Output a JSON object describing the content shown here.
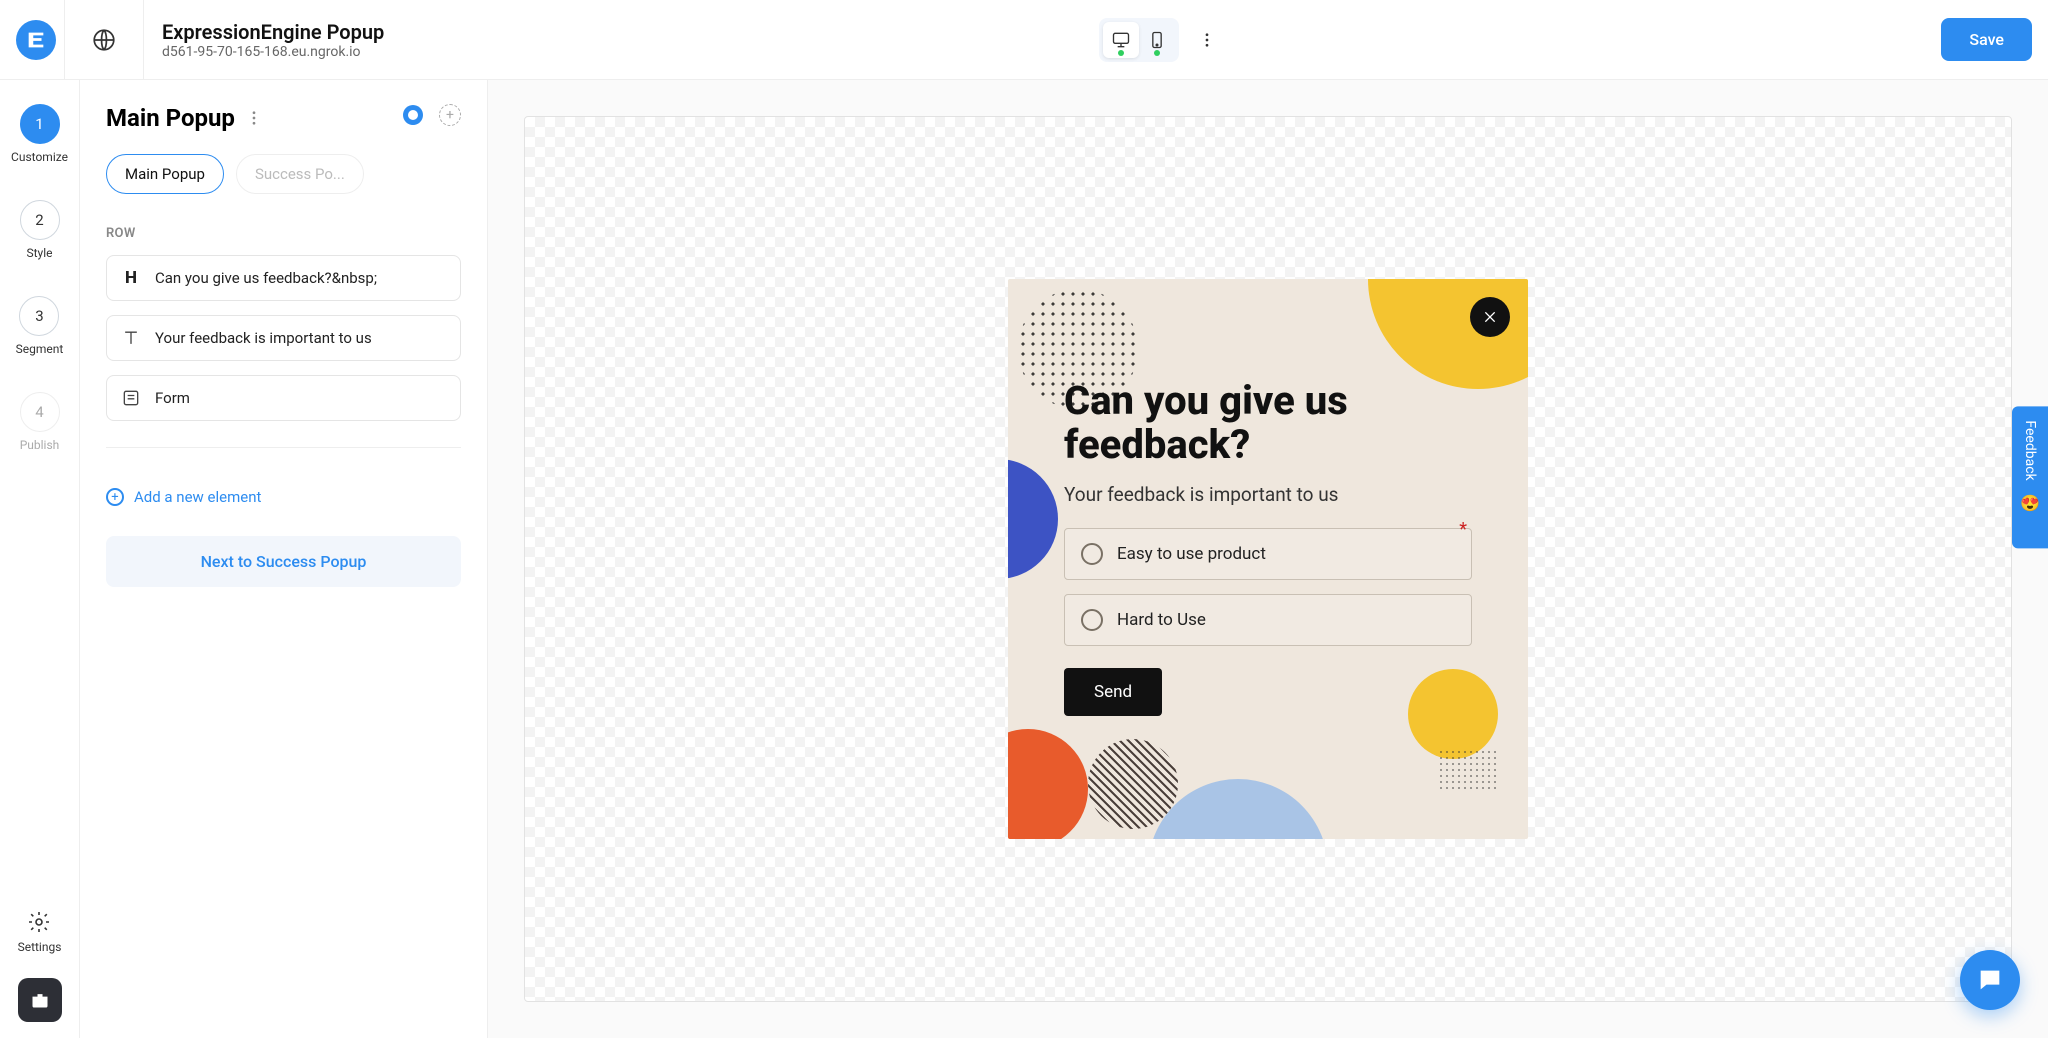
{
  "header": {
    "title": "ExpressionEngine Popup",
    "subtitle": "d561-95-70-165-168.eu.ngrok.io",
    "save_label": "Save"
  },
  "rail": {
    "steps": [
      {
        "num": "1",
        "label": "Customize"
      },
      {
        "num": "2",
        "label": "Style"
      },
      {
        "num": "3",
        "label": "Segment"
      },
      {
        "num": "4",
        "label": "Publish"
      }
    ],
    "settings_label": "Settings"
  },
  "panel": {
    "title": "Main Popup",
    "tabs": [
      {
        "label": "Main Popup"
      },
      {
        "label": "Success Po..."
      }
    ],
    "row_label": "ROW",
    "rows": [
      {
        "text": "Can you give us feedback?&nbsp;"
      },
      {
        "text": "Your feedback is important to us"
      },
      {
        "text": "Form"
      }
    ],
    "add_element_label": "Add a new element",
    "next_label": "Next to Success Popup"
  },
  "popup": {
    "heading": "Can you give us feedback?",
    "subheading": "Your feedback is important to us",
    "options": [
      {
        "label": "Easy to use product"
      },
      {
        "label": "Hard to Use"
      }
    ],
    "send_label": "Send"
  },
  "feedback_tab": {
    "label": "Feedback",
    "emoji": "😍"
  }
}
